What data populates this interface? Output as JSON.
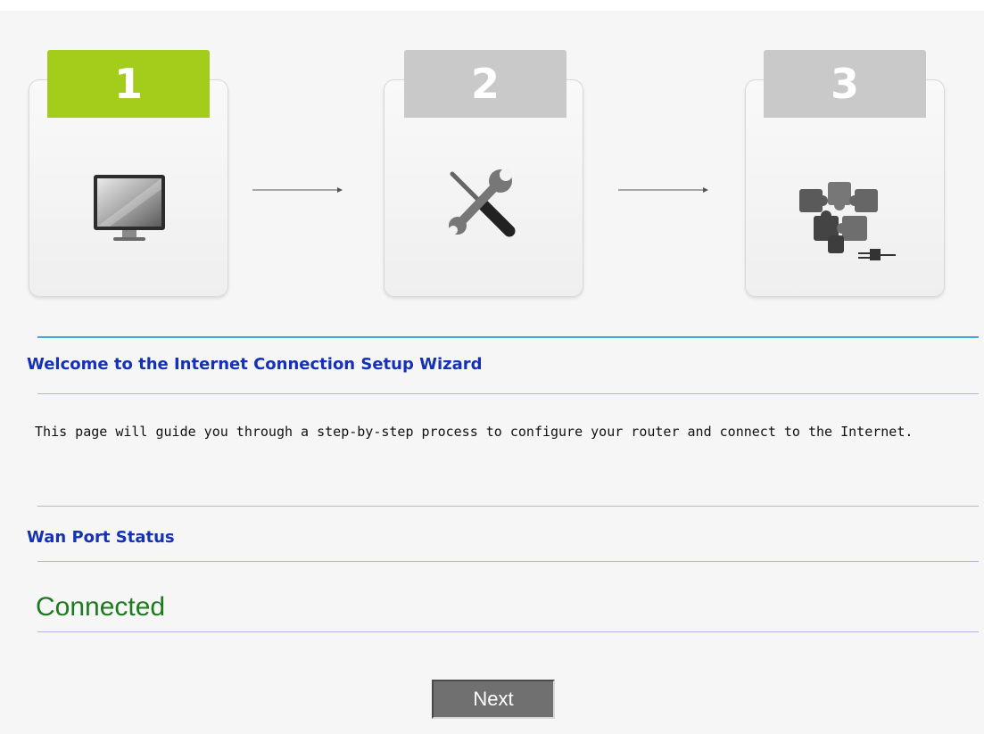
{
  "wizard": {
    "steps": [
      {
        "number": "1",
        "icon": "monitor-icon",
        "state": "active"
      },
      {
        "number": "2",
        "icon": "tools-icon",
        "state": "inactive"
      },
      {
        "number": "3",
        "icon": "puzzle-icon",
        "state": "inactive"
      }
    ],
    "active_color": "#a4cd1b",
    "inactive_color": "#c9c9c9"
  },
  "welcome": {
    "title": "Welcome to the Internet Connection Setup Wizard",
    "description": " This page will guide you through a step-by-step process to configure your router and connect to the Internet."
  },
  "wan": {
    "title": "Wan Port Status",
    "status": "Connected",
    "status_color": "#1e7a1e"
  },
  "actions": {
    "next_label": "Next"
  }
}
